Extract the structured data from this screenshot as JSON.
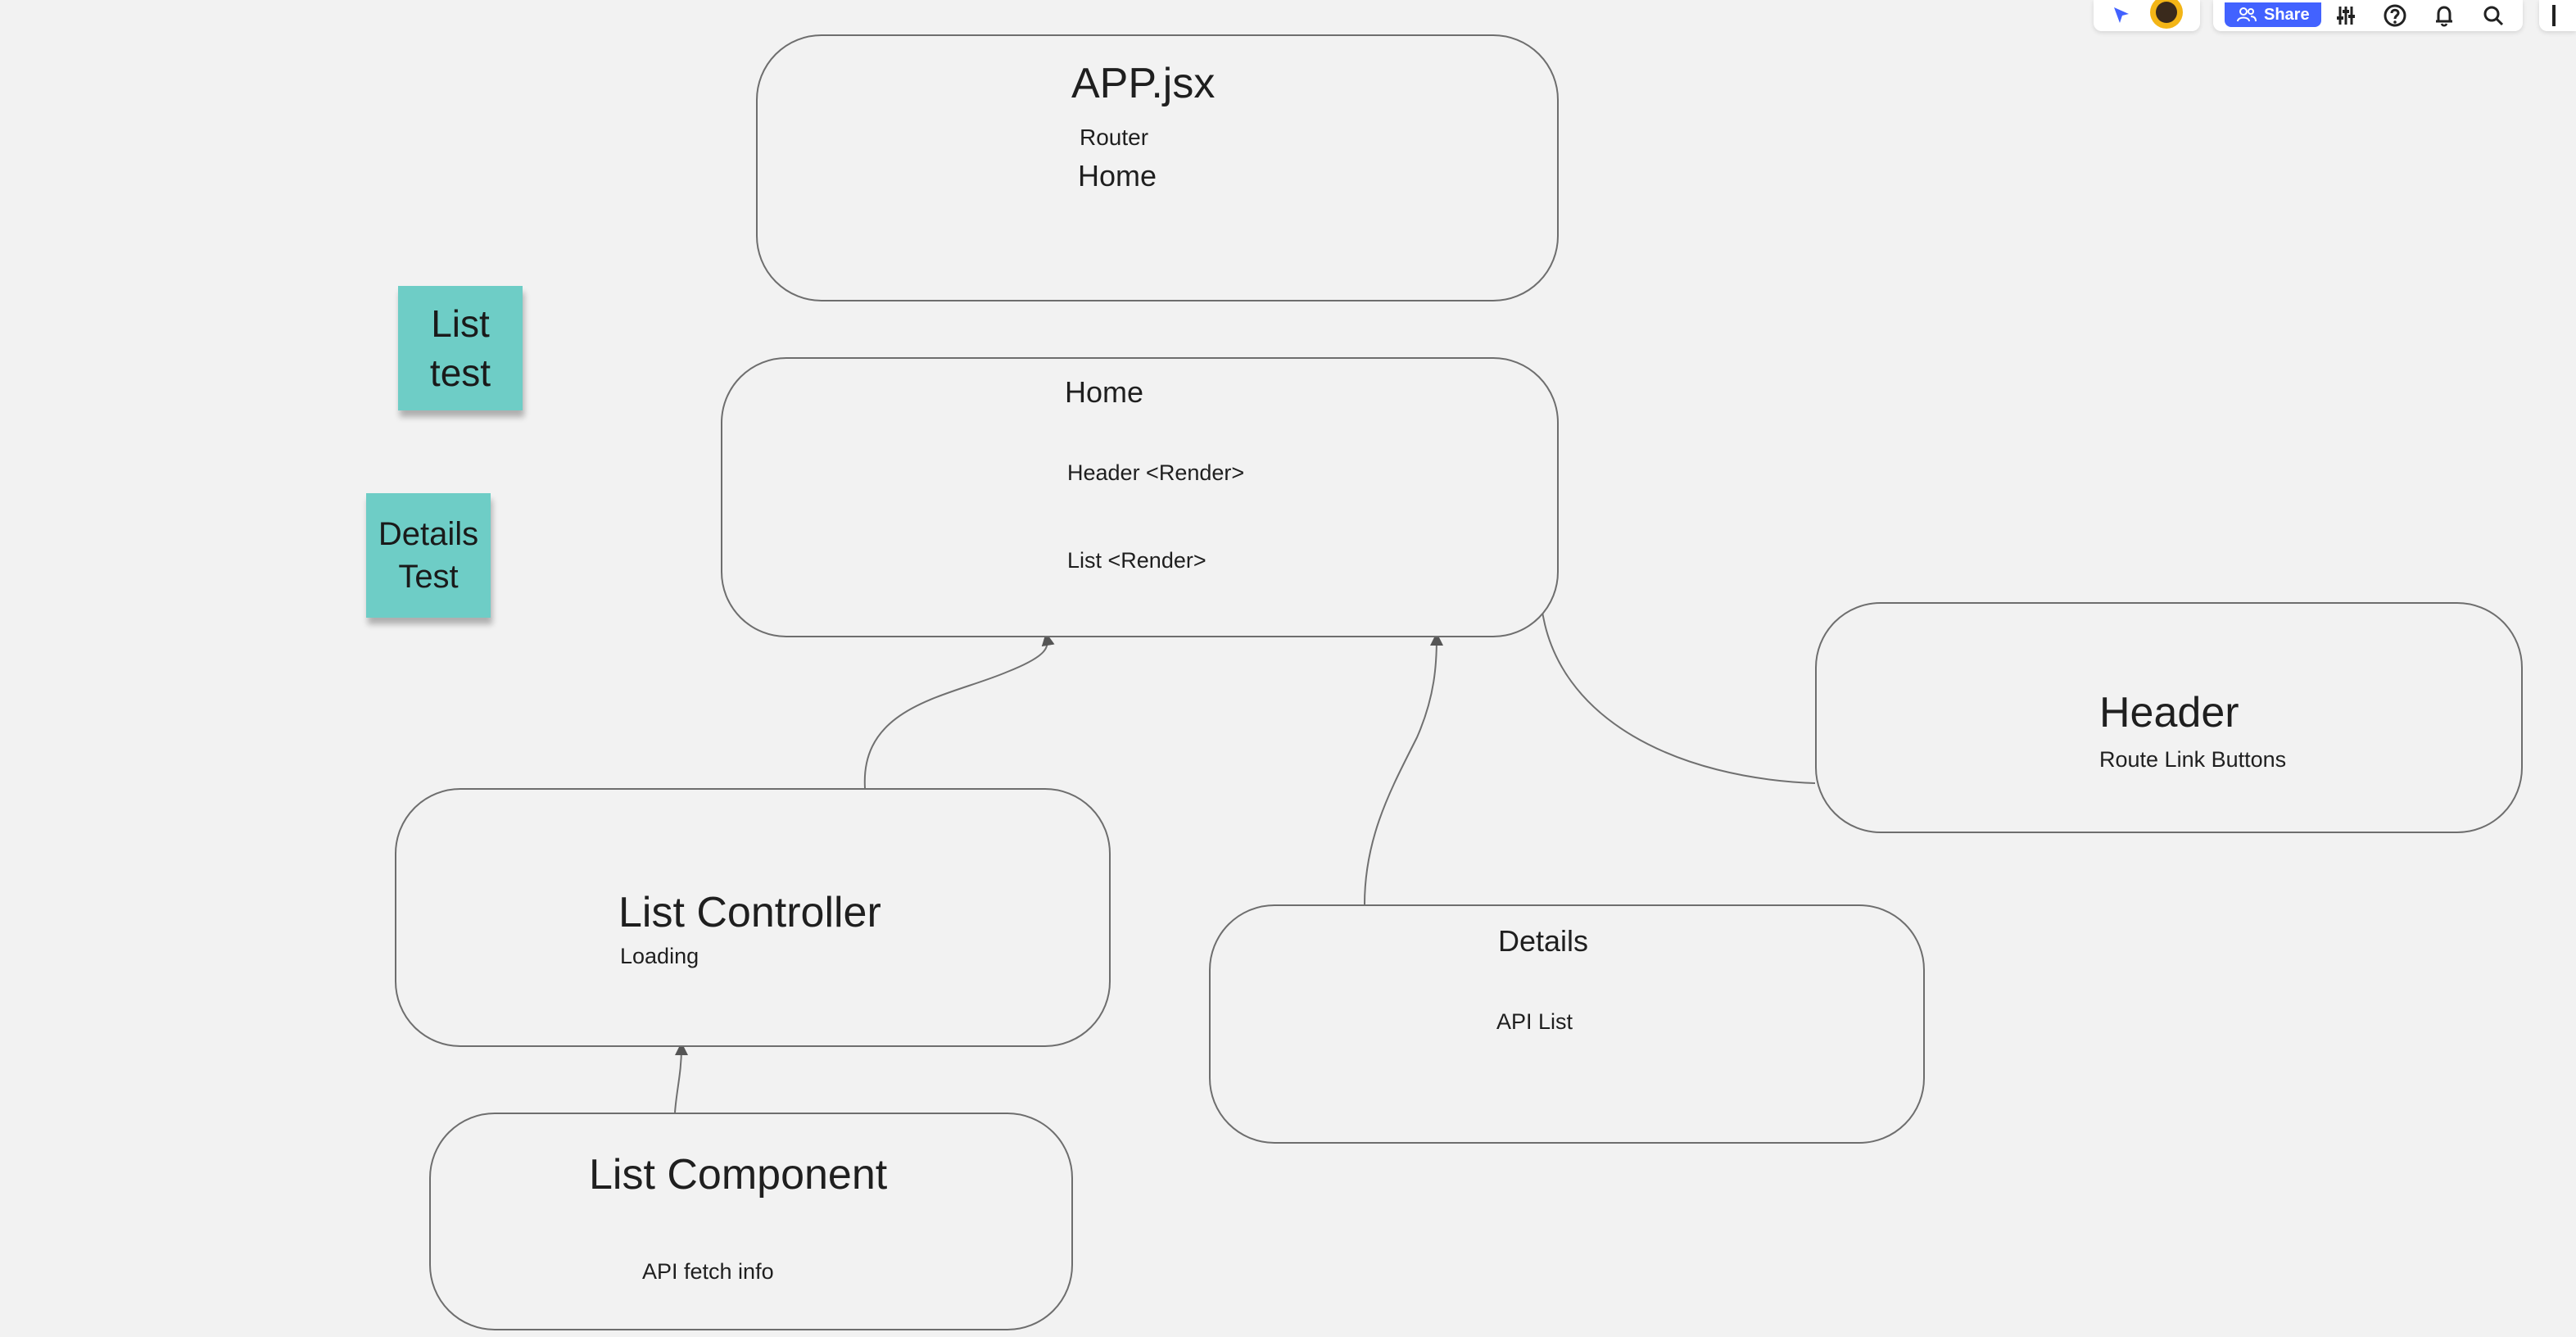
{
  "toolbar": {
    "share_label": "Share"
  },
  "diagram": {
    "app_box": {
      "title": "APP.jsx",
      "line1": "Router",
      "line2": "Home"
    },
    "home_box": {
      "title": "Home",
      "line1": "Header <Render>",
      "line2": "List <Render>"
    },
    "header_box": {
      "title": "Header",
      "line1": "Route Link Buttons"
    },
    "list_controller_box": {
      "title": "List Controller",
      "line1": "Loading"
    },
    "details_box": {
      "title": "Details",
      "line1": "API List"
    },
    "list_component_box": {
      "title": "List Component",
      "line1": "API fetch info"
    }
  },
  "stickies": {
    "list_test": {
      "line1": "List",
      "line2": "test"
    },
    "details_test": {
      "line1": "Details",
      "line2": "Test"
    }
  },
  "colors": {
    "canvas": "#f2f2f2",
    "sticky": "#6ecdc6",
    "accent": "#4262ff",
    "stroke": "#6e6e6e"
  }
}
